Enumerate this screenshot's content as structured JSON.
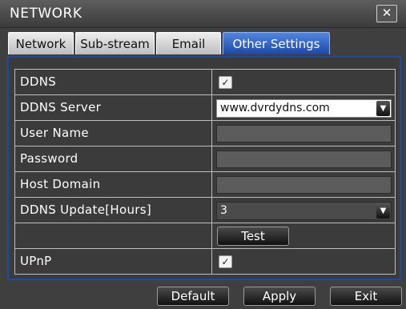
{
  "window": {
    "title": "NETWORK",
    "close_glyph": "✕"
  },
  "tabs": [
    {
      "label": "Network",
      "active": false
    },
    {
      "label": "Sub-stream",
      "active": false
    },
    {
      "label": "Email",
      "active": false
    },
    {
      "label": "Other Settings",
      "active": true
    }
  ],
  "form": {
    "ddns": {
      "label": "DDNS",
      "checked": true,
      "check_glyph": "✓"
    },
    "ddns_server": {
      "label": "DDNS Server",
      "value": "www.dvrdydns.com",
      "arrow": "▼"
    },
    "user_name": {
      "label": "User Name",
      "value": ""
    },
    "password": {
      "label": "Password",
      "value": ""
    },
    "host_domain": {
      "label": "Host Domain",
      "value": ""
    },
    "ddns_update": {
      "label": "DDNS Update[Hours]",
      "value": "3",
      "arrow": "▼"
    },
    "test_label": "Test",
    "upnp": {
      "label": "UPnP",
      "checked": true,
      "check_glyph": "✓"
    }
  },
  "footer": {
    "default_label": "Default",
    "apply_label": "Apply",
    "exit_label": "Exit"
  },
  "colors": {
    "accent_blue": "#1c48a8",
    "background": "#3f3f3f",
    "border": "#bdbdbd"
  }
}
